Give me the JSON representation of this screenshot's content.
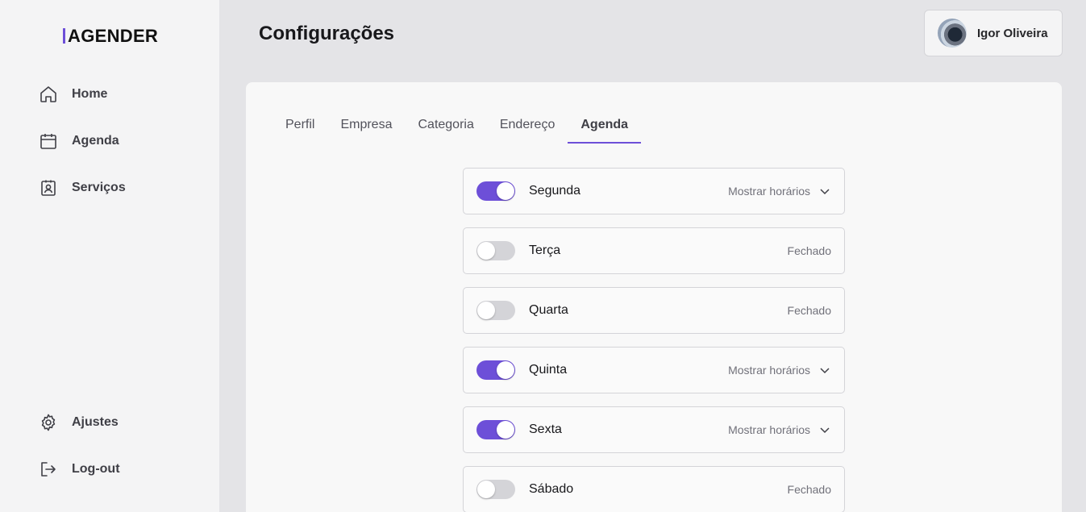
{
  "sidebar": {
    "logo": "AGENDER",
    "items": [
      {
        "label": "Home",
        "icon": "home-icon"
      },
      {
        "label": "Agenda",
        "icon": "calendar-icon"
      },
      {
        "label": "Serviços",
        "icon": "id-badge-icon"
      }
    ],
    "bottom_items": [
      {
        "label": "Ajustes",
        "icon": "gear-icon"
      },
      {
        "label": "Log-out",
        "icon": "logout-icon"
      }
    ]
  },
  "header": {
    "title": "Configurações",
    "user_name": "Igor Oliveira"
  },
  "tabs": [
    {
      "label": "Perfil"
    },
    {
      "label": "Empresa"
    },
    {
      "label": "Categoria"
    },
    {
      "label": "Endereço"
    },
    {
      "label": "Agenda",
      "active": true
    }
  ],
  "schedule": {
    "days": [
      {
        "name": "Segunda",
        "enabled": true,
        "status": "Mostrar horários"
      },
      {
        "name": "Terça",
        "enabled": false,
        "status": "Fechado"
      },
      {
        "name": "Quarta",
        "enabled": false,
        "status": "Fechado"
      },
      {
        "name": "Quinta",
        "enabled": true,
        "status": "Mostrar horários"
      },
      {
        "name": "Sexta",
        "enabled": true,
        "status": "Mostrar horários"
      },
      {
        "name": "Sábado",
        "enabled": false,
        "status": "Fechado"
      }
    ]
  },
  "colors": {
    "accent": "#6d4fd8",
    "toggle_off": "#d4d4d8",
    "background": "#e4e4e7",
    "sidebar": "#f4f4f5"
  }
}
